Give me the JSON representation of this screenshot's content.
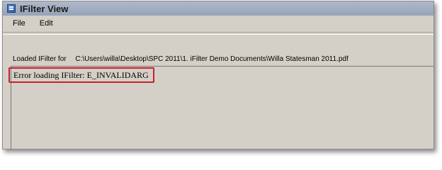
{
  "window": {
    "title": "IFilter View"
  },
  "menu": {
    "items": [
      "File",
      "Edit"
    ]
  },
  "loaded": {
    "label": "Loaded IFilter for",
    "path": "C:\\Users\\willa\\Desktop\\SPC 2011\\1. iFilter Demo Documents\\Willa Statesman 2011.pdf"
  },
  "output": {
    "message": "Error loading IFilter: E_INVALIDARG"
  },
  "colors": {
    "highlight_border": "#c8202c",
    "window_bg": "#d4d0c8"
  }
}
